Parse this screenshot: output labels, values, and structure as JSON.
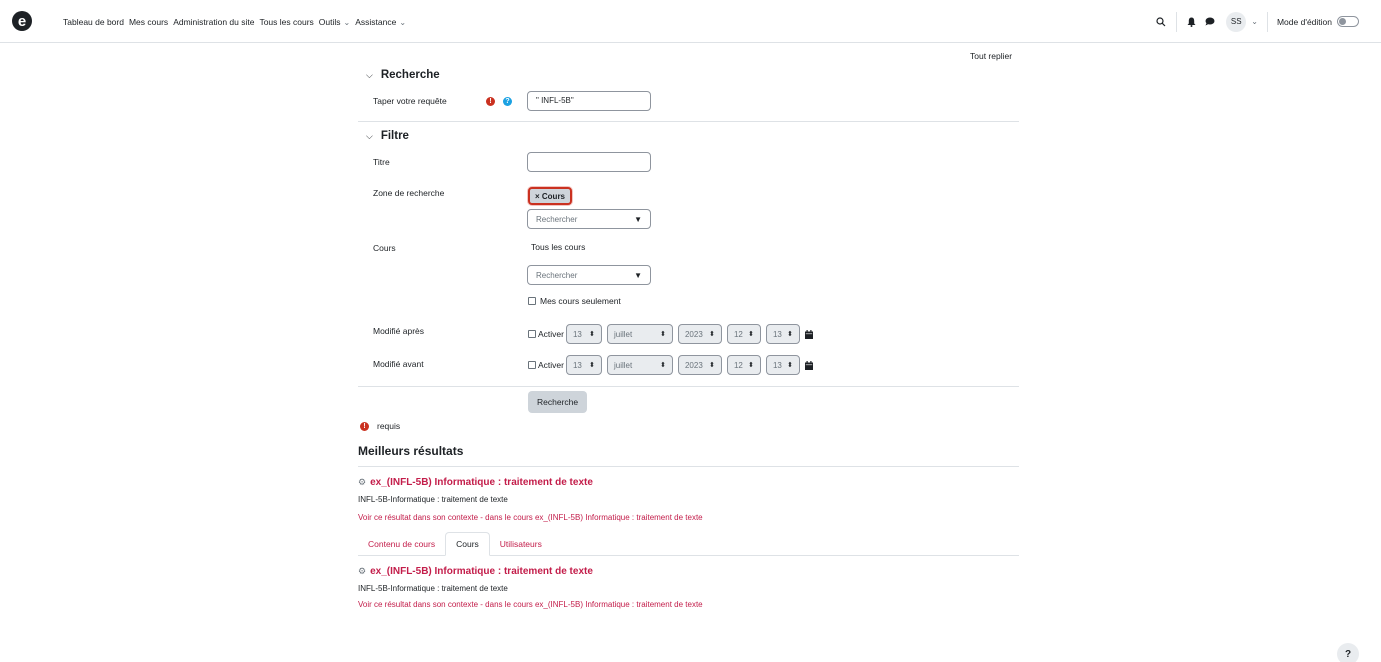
{
  "navbar": {
    "logo": "e",
    "links": [
      "Tableau de bord",
      "Mes cours",
      "Administration du site",
      "Tous les cours",
      "Outils",
      "Assistance"
    ],
    "avatar_initials": "SS",
    "edit_mode_label": "Mode d'édition"
  },
  "page": {
    "collapse_all": "Tout replier",
    "search_section": {
      "title": "Recherche",
      "query_label": "Taper votre requête",
      "query_value": "\" INFL-5B\""
    },
    "filter_section": {
      "title": "Filtre",
      "title_label": "Titre",
      "title_value": "",
      "area_label": "Zone de recherche",
      "area_badge": "× Cours",
      "area_search_placeholder": "Rechercher",
      "courses_label": "Cours",
      "courses_value": "Tous les cours",
      "courses_search_placeholder": "Rechercher",
      "my_courses_only": "Mes cours seulement",
      "modified_after_label": "Modifié après",
      "modified_before_label": "Modifié avant",
      "enable_label": "Activer",
      "date": {
        "day": "13",
        "month": "juillet",
        "year": "2023",
        "hour": "12",
        "minute": "13"
      }
    },
    "search_button": "Recherche",
    "required_note": "requis",
    "top_results_title": "Meilleurs résultats",
    "top_result": {
      "title": "ex_(INFL-5B) Informatique : traitement de texte",
      "description": "INFL-5B-Informatique : traitement de texte",
      "link": "Voir ce résultat dans son contexte - dans le cours ex_(INFL-5B) Informatique : traitement de texte"
    },
    "tabs": [
      "Contenu de cours",
      "Cours",
      "Utilisateurs"
    ],
    "active_tab": "Cours",
    "tab_result": {
      "title": "ex_(INFL-5B) Informatique : traitement de texte",
      "description": "INFL-5B-Informatique : traitement de texte",
      "link": "Voir ce résultat dans son contexte - dans le cours ex_(INFL-5B) Informatique : traitement de texte"
    },
    "help_button": "?"
  },
  "colors": {
    "link": "#c31d4a",
    "required": "#ca3120",
    "help": "#1ba1e2",
    "border": "#dee2e6"
  }
}
